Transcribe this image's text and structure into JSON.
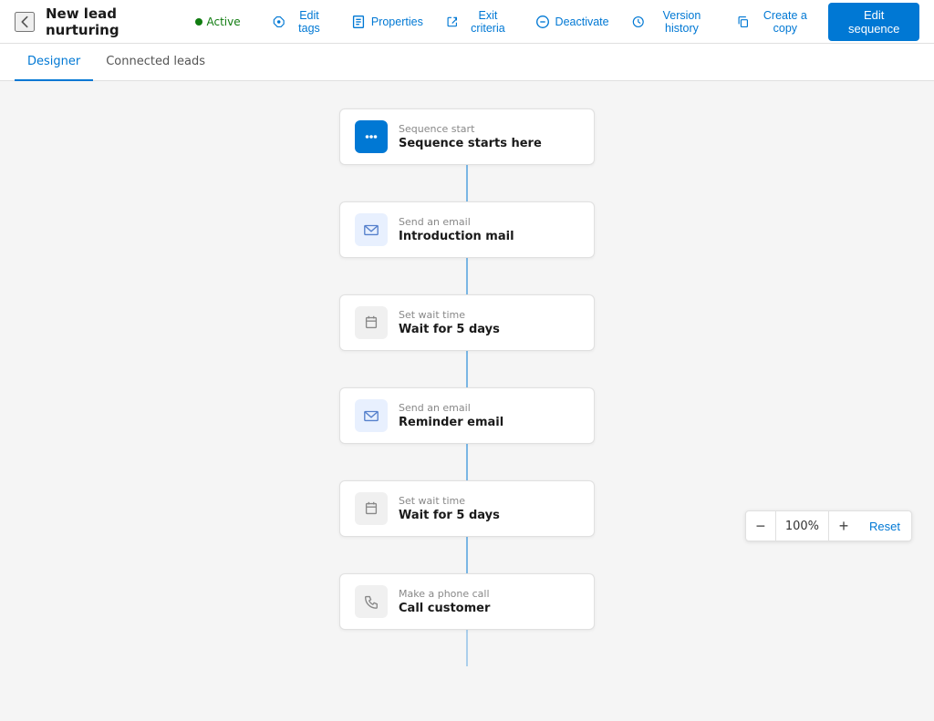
{
  "header": {
    "back_label": "←",
    "title": "New lead nurturing",
    "status": "Active",
    "actions": [
      {
        "id": "edit-tags",
        "label": "Edit tags",
        "icon": "tag"
      },
      {
        "id": "properties",
        "label": "Properties",
        "icon": "doc"
      },
      {
        "id": "exit-criteria",
        "label": "Exit criteria",
        "icon": "exit"
      },
      {
        "id": "deactivate",
        "label": "Deactivate",
        "icon": "deactivate"
      },
      {
        "id": "version-history",
        "label": "Version history",
        "icon": "history"
      },
      {
        "id": "create-copy",
        "label": "Create a copy",
        "icon": "copy"
      }
    ],
    "edit_sequence_label": "Edit sequence"
  },
  "tabs": [
    {
      "id": "designer",
      "label": "Designer",
      "active": true
    },
    {
      "id": "connected-leads",
      "label": "Connected leads",
      "active": false
    }
  ],
  "nodes": [
    {
      "id": "sequence-start",
      "icon_type": "blue-bg",
      "icon": "sequence",
      "label": "Sequence start",
      "title": "Sequence starts here"
    },
    {
      "id": "send-email-1",
      "icon_type": "light-bg",
      "icon": "email",
      "label": "Send an email",
      "title": "Introduction mail"
    },
    {
      "id": "wait-1",
      "icon_type": "wait-bg",
      "icon": "wait",
      "label": "Set wait time",
      "title": "Wait for 5 days"
    },
    {
      "id": "send-email-2",
      "icon_type": "light-bg",
      "icon": "email",
      "label": "Send an email",
      "title": "Reminder email"
    },
    {
      "id": "wait-2",
      "icon_type": "wait-bg",
      "icon": "wait",
      "label": "Set wait time",
      "title": "Wait for 5 days"
    },
    {
      "id": "phone-call",
      "icon_type": "phone-bg",
      "icon": "phone",
      "label": "Make a phone call",
      "title": "Call customer"
    }
  ],
  "zoom": {
    "minus_label": "−",
    "plus_label": "+",
    "value": "100%",
    "reset_label": "Reset"
  }
}
